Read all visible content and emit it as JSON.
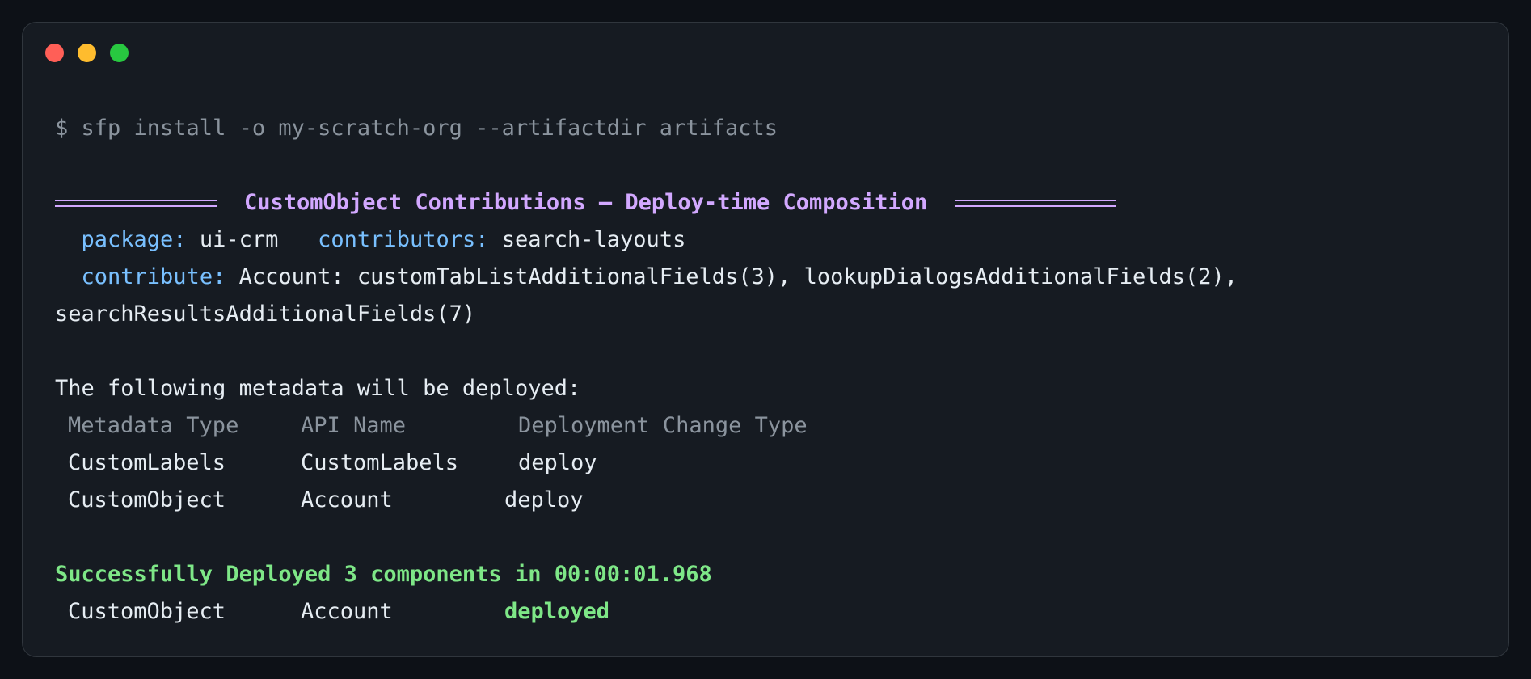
{
  "window": {
    "controls": [
      "close",
      "minimize",
      "zoom"
    ]
  },
  "terminal": {
    "command": "$ sfp install -o my-scratch-org --artifactdir artifacts",
    "banner_title": "CustomObject Contributions — Deploy-time Composition",
    "package_label": "package:",
    "package_value": "ui-crm",
    "contributors_label": "contributors:",
    "contributors_value": "search-layouts",
    "contribute_label": "contribute:",
    "contribute_value": "Account: customTabListAdditionalFields(3), lookupDialogsAdditionalFields(2),",
    "contribute_value_wrap": "searchResultsAdditionalFields(7)",
    "deploy_intro": "The following metadata will be deployed:",
    "table_headers": [
      "Metadata Type",
      "API Name",
      "Deployment Change Type"
    ],
    "table_rows": [
      [
        "CustomLabels",
        "CustomLabels",
        "deploy"
      ],
      [
        "CustomObject",
        "Account",
        "deploy"
      ]
    ],
    "success_message": "Successfully Deployed 3 components in 00:00:01.968",
    "result_row": [
      "CustomObject",
      "Account",
      "deployed"
    ]
  },
  "colors": {
    "background": "#0d1117",
    "window": "#161b22",
    "banner": "#d2a8ff",
    "key": "#79c0ff",
    "success": "#7ee787",
    "muted": "#8b949e"
  }
}
